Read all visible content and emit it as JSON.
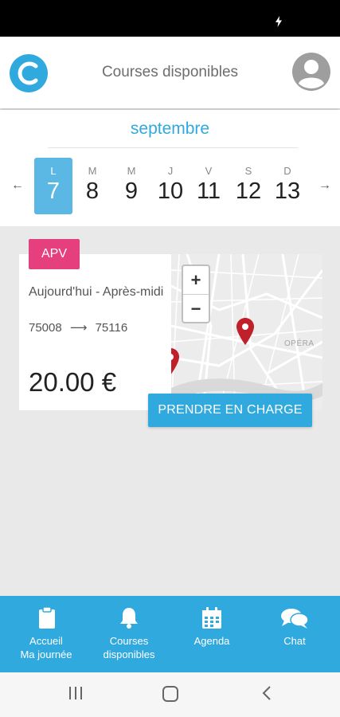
{
  "header": {
    "title": "Courses disponibles"
  },
  "calendar": {
    "month": "septembre",
    "prev_icon": "arrow-left",
    "next_icon": "arrow-right",
    "days": [
      {
        "letter": "L",
        "number": "7",
        "selected": true
      },
      {
        "letter": "M",
        "number": "8",
        "selected": false
      },
      {
        "letter": "M",
        "number": "9",
        "selected": false
      },
      {
        "letter": "J",
        "number": "10",
        "selected": false
      },
      {
        "letter": "V",
        "number": "11",
        "selected": false
      },
      {
        "letter": "S",
        "number": "12",
        "selected": false
      },
      {
        "letter": "D",
        "number": "13",
        "selected": false
      }
    ]
  },
  "ride": {
    "badge": "APV",
    "when": "Aujourd'hui - Après-midi",
    "from": "75008",
    "to": "75116",
    "price": "20.00 €",
    "action_label": "PRENDRE EN CHARGE",
    "map_place": "OPÉRA",
    "zoom_in": "+",
    "zoom_out": "−"
  },
  "bottom_nav": [
    {
      "label": "Accueil\nMa journée",
      "icon": "clipboard-icon"
    },
    {
      "label": "Courses\ndisponibles",
      "icon": "bell-icon"
    },
    {
      "label": "Agenda",
      "icon": "calendar-icon"
    },
    {
      "label": "Chat",
      "icon": "chat-icon"
    }
  ],
  "colors": {
    "accent": "#30a9df",
    "badge": "#e53f7d",
    "selected_day": "#5bb7e3",
    "marker": "#c0202a"
  }
}
